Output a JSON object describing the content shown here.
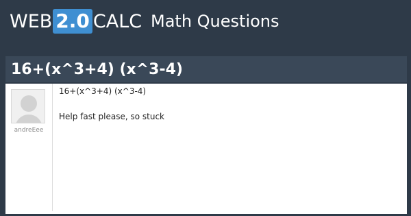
{
  "header": {
    "logo": {
      "web": "WEB",
      "version": "2.0",
      "calc": "CALC"
    },
    "section": "Math Questions"
  },
  "question": {
    "title": "16+(x^3+4) (x^3-4)",
    "user": "andreEee",
    "body_lines": [
      "16+(x^3+4) (x^3-4)",
      "Help fast please, so stuck"
    ]
  },
  "colors": {
    "page_bg": "#2e3a48",
    "title_bar": "#3a4858",
    "logo_badge": "#3f8fd2"
  }
}
